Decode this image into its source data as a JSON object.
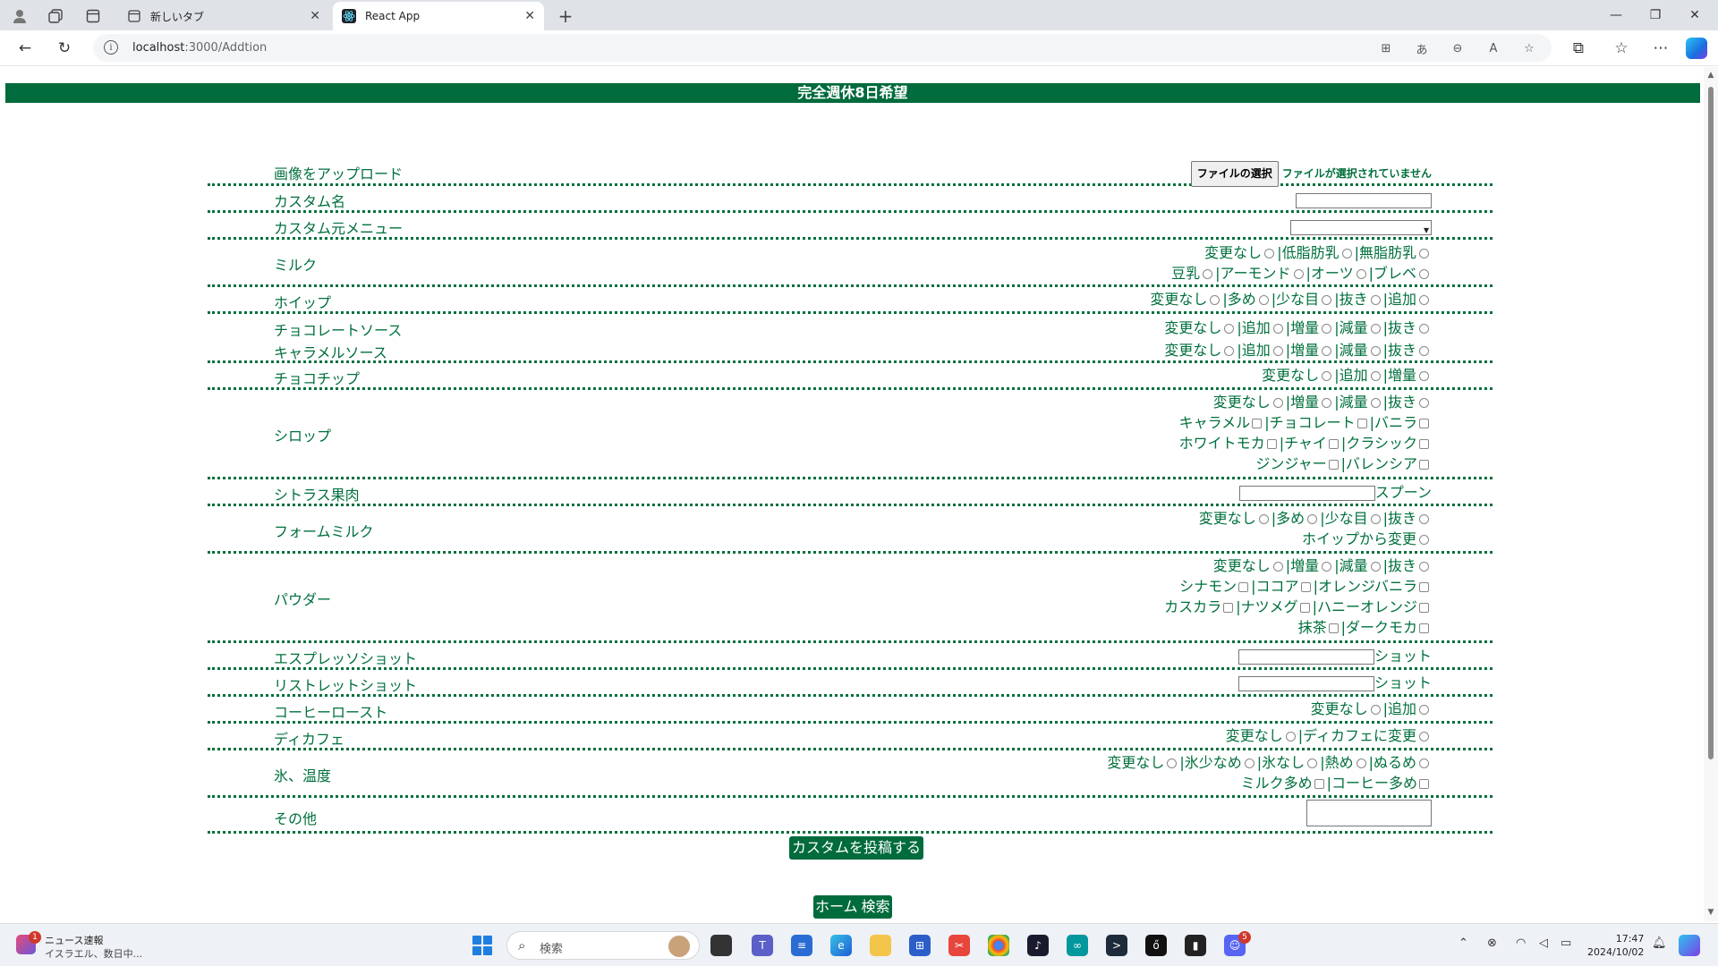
{
  "browser": {
    "tabs": [
      {
        "title": "新しいタブ"
      },
      {
        "title": "React App"
      }
    ],
    "url_host": "localhost",
    "url_path": ":3000/Addtion"
  },
  "page": {
    "header": "完全週休8日希望",
    "upload": {
      "label": "画像をアップロード",
      "button": "ファイルの選択",
      "status": "ファイルが選択されていません"
    },
    "custom_name": {
      "label": "カスタム名",
      "value": ""
    },
    "base_menu": {
      "label": "カスタム元メニュー",
      "value": ""
    },
    "milk": {
      "label": "ミルク",
      "lines": [
        [
          "変更なし",
          "|低脂肪乳",
          "|無脂肪乳"
        ],
        [
          "豆乳",
          "|アーモンド",
          "|オーツ",
          "|ブレベ"
        ]
      ]
    },
    "whip": {
      "label": "ホイップ",
      "lines": [
        [
          "変更なし",
          "|多め",
          "|少な目",
          "|抜き",
          "|追加"
        ]
      ]
    },
    "choco_sauce": {
      "label": "チョコレートソース",
      "lines": [
        [
          "変更なし",
          "|追加",
          "|増量",
          "|減量",
          "|抜き"
        ]
      ]
    },
    "caramel_sauce": {
      "label": "キャラメルソース",
      "lines": [
        [
          "変更なし",
          "|追加",
          "|増量",
          "|減量",
          "|抜き"
        ]
      ]
    },
    "choco_chip": {
      "label": "チョコチップ",
      "lines": [
        [
          "変更なし",
          "|追加",
          "|増量"
        ]
      ]
    },
    "syrup": {
      "label": "シロップ",
      "radio_line": [
        "変更なし",
        "|増量",
        "|減量",
        "|抜き"
      ],
      "check_lines": [
        [
          "キャラメル",
          "|チョコレート",
          "|バニラ"
        ],
        [
          "ホワイトモカ",
          "|チャイ",
          "|クラシック"
        ],
        [
          "ジンジャー",
          "|バレンシア"
        ]
      ]
    },
    "citrus": {
      "label": "シトラス果肉",
      "unit": "スプーン"
    },
    "foam_milk": {
      "label": "フォームミルク",
      "lines": [
        [
          "変更なし",
          "|多め",
          "|少な目",
          "|抜き"
        ],
        [
          "ホイップから変更"
        ]
      ]
    },
    "powder": {
      "label": "パウダー",
      "radio_line": [
        "変更なし",
        "|増量",
        "|減量",
        "|抜き"
      ],
      "check_lines": [
        [
          "シナモン",
          "|ココア",
          "|オレンジバニラ"
        ],
        [
          "カスカラ",
          "|ナツメグ",
          "|ハニーオレンジ"
        ],
        [
          "抹茶",
          "|ダークモカ"
        ]
      ]
    },
    "espresso": {
      "label": "エスプレッソショット",
      "unit": "ショット"
    },
    "ristretto": {
      "label": "リストレットショット",
      "unit": "ショット"
    },
    "coffee_roast": {
      "label": "コーヒーロースト",
      "lines": [
        [
          "変更なし",
          "|追加"
        ]
      ]
    },
    "decaf": {
      "label": "ディカフェ",
      "lines": [
        [
          "変更なし",
          "|ディカフェに変更"
        ]
      ]
    },
    "ice_temp": {
      "label": "氷、温度",
      "radio_line": [
        "変更なし",
        "|氷少なめ",
        "|氷なし",
        "|熱め",
        "|ぬるめ"
      ],
      "check_lines": [
        [
          "ミルク多め",
          "|コーヒー多め"
        ]
      ]
    },
    "other": {
      "label": "その他"
    },
    "submit": "カスタムを投稿する",
    "nav": [
      "ホーム",
      "検索"
    ]
  },
  "taskbar": {
    "news_title": "ニュース速報",
    "news_sub": "イスラエル、数日中...",
    "news_badge": "1",
    "search_placeholder": "検索",
    "discord_badge": "5",
    "time": "17:47",
    "date": "2024/10/02"
  }
}
